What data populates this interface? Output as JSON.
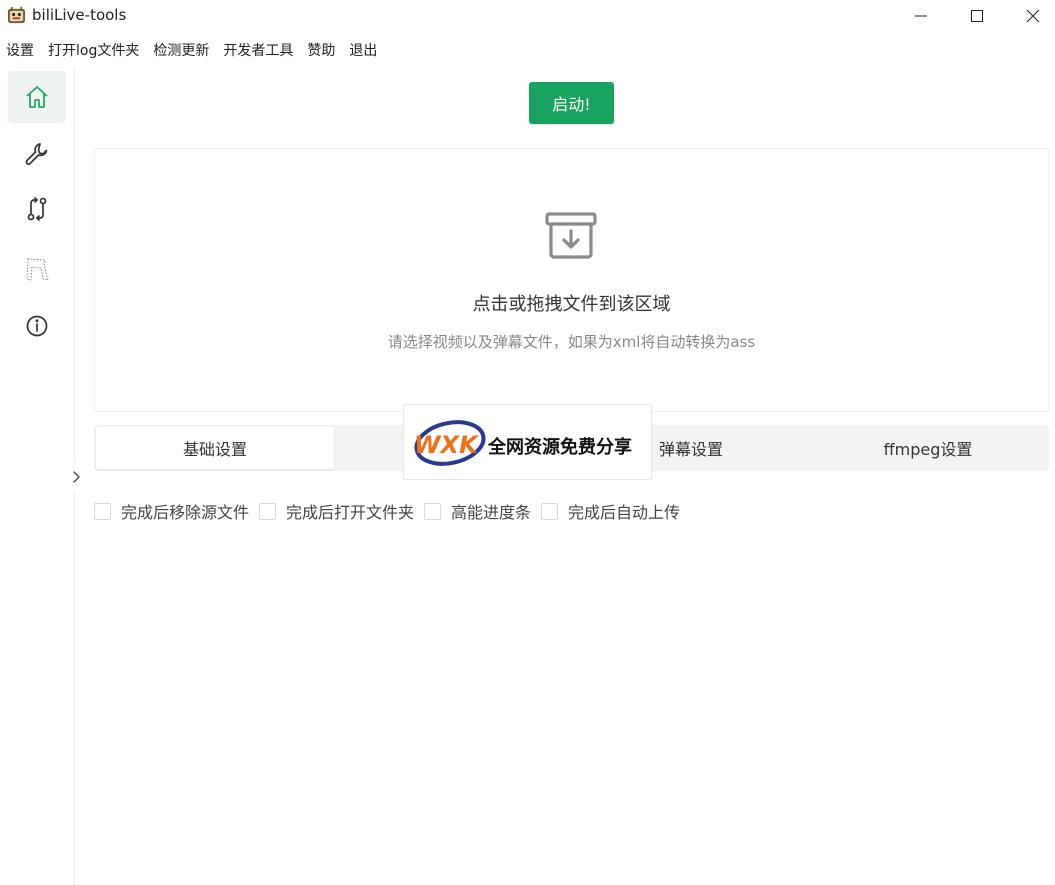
{
  "window": {
    "title": "biliLive-tools",
    "app_icon": "app-logo-icon",
    "controls": [
      "minimize-icon",
      "maximize-icon",
      "close-icon"
    ]
  },
  "menu": [
    {
      "label": "设置"
    },
    {
      "label": "打开log文件夹"
    },
    {
      "label": "检测更新"
    },
    {
      "label": "开发者工具"
    },
    {
      "label": "赞助"
    },
    {
      "label": "退出"
    }
  ],
  "sidebar": {
    "items": [
      {
        "icon": "home-icon",
        "active": true
      },
      {
        "icon": "wrench-icon",
        "active": false
      },
      {
        "icon": "git-compare-icon",
        "active": false
      },
      {
        "icon": "dotted-shape-icon",
        "active": false
      },
      {
        "icon": "info-icon",
        "active": false
      }
    ],
    "collapse_icon": "chevron-right-icon"
  },
  "main": {
    "start_button": "启动!",
    "dropzone": {
      "icon": "archive-download-icon",
      "title": "点击或拖拽文件到该区域",
      "hint": "请选择视频以及弹幕文件，如果为xml将自动转换为ass"
    },
    "tabs": [
      {
        "label": "基础设置",
        "active": true
      },
      {
        "label": "",
        "active": false
      },
      {
        "label": "弹幕设置",
        "active": false
      },
      {
        "label": "ffmpeg设置",
        "active": false
      }
    ],
    "options": [
      {
        "label": "完成后移除源文件",
        "checked": false
      },
      {
        "label": "完成后打开文件夹",
        "checked": false
      },
      {
        "label": "高能进度条",
        "checked": false
      },
      {
        "label": "完成后自动上传",
        "checked": false
      }
    ]
  },
  "watermark": {
    "logo_text": "WXK",
    "text": "全网资源免费分享"
  },
  "colors": {
    "accent": "#1aa260",
    "sidebar_active_bg": "#eef3f1",
    "tabs_bg": "#f3f3f3",
    "icon_active": "#2ba36b",
    "icon_default": "#333333"
  }
}
